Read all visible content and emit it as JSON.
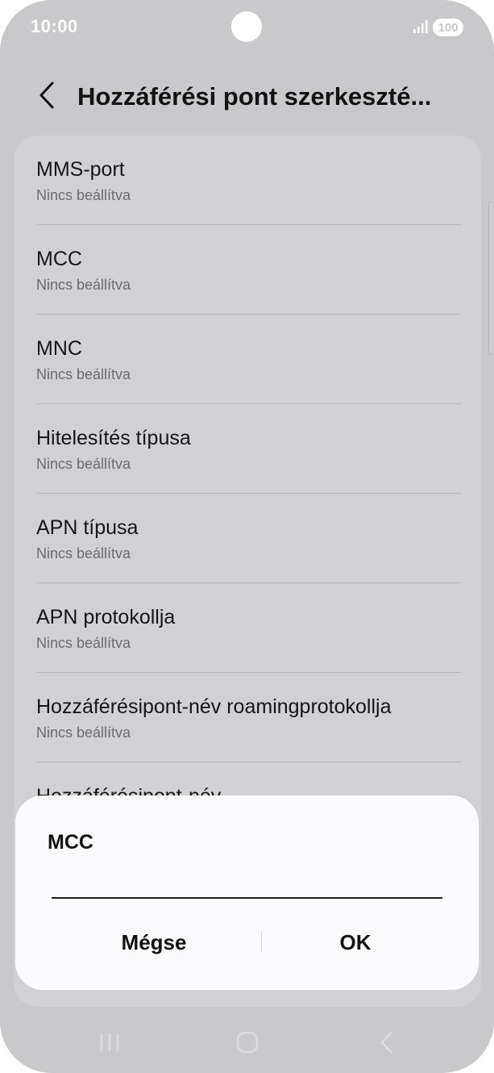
{
  "status_bar": {
    "time": "10:00",
    "battery_level": "100"
  },
  "header": {
    "title": "Hozzáférési pont szerkeszté..."
  },
  "settings": {
    "items": [
      {
        "title": "MMS-port",
        "subtitle": "Nincs beállítva"
      },
      {
        "title": "MCC",
        "subtitle": "Nincs beállítva"
      },
      {
        "title": "MNC",
        "subtitle": "Nincs beállítva"
      },
      {
        "title": "Hitelesítés típusa",
        "subtitle": "Nincs beállítva"
      },
      {
        "title": "APN típusa",
        "subtitle": "Nincs beállítva"
      },
      {
        "title": "APN protokollja",
        "subtitle": "Nincs beállítva"
      },
      {
        "title": "Hozzáférésipont-név roamingprotokollja",
        "subtitle": "Nincs beállítva"
      },
      {
        "title": "Hozzáférésipont-név",
        "subtitle": ""
      }
    ]
  },
  "dialog": {
    "title": "MCC",
    "input_value": "",
    "cancel_label": "Mégse",
    "ok_label": "OK"
  },
  "icons": {
    "back": "chevron-left-icon",
    "nav_recents": "recents-icon",
    "nav_home": "home-icon",
    "nav_back": "back-icon",
    "signal": "signal-icon"
  },
  "colors": {
    "screen_dim": "#c9c9cb",
    "card": "#d1d1d4",
    "dialog": "#fbfbfd",
    "text_primary": "#121212",
    "text_secondary": "#6d6d70"
  }
}
